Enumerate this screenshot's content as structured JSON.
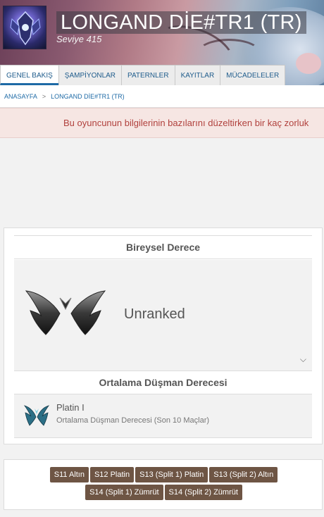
{
  "profile": {
    "name": "LONGAND DİE#TR1 (TR)",
    "level": "Seviye 415"
  },
  "tabs": [
    {
      "label": "GENEL BAKIŞ",
      "active": true
    },
    {
      "label": "ŞAMPİYONLAR",
      "active": false
    },
    {
      "label": "PATERNLER",
      "active": false
    },
    {
      "label": "KAYITLAR",
      "active": false
    },
    {
      "label": "MÜCADELELER",
      "active": false
    }
  ],
  "breadcrumb": {
    "home": "ANASAYFA",
    "separator": ">",
    "current": "LONGAND DİE#TR1 (TR)"
  },
  "alert": {
    "text": "Bu oyuncunun bilgilerinin bazılarını düzeltirken bir kaç zorluk"
  },
  "ranked": {
    "section_title": "Bireysel Derece",
    "status": "Unranked",
    "expand_icon": "chevron-down-icon"
  },
  "enemy_rank": {
    "section_title": "Ortalama Düşman Derecesi",
    "tier": "Platin I",
    "subtitle": "Ortalama Düşman Derecesi (Son 10 Maçlar)"
  },
  "seasons": [
    "S11 Altın",
    "S12 Platin",
    "S13 (Split 1) Platin",
    "S13 (Split 2) Altın",
    "S14 (Split 1) Zümrüt",
    "S14 (Split 2) Zümrüt"
  ],
  "colors": {
    "link": "#1e6aa6",
    "alert_text": "#b1413d",
    "alert_bg": "#f6e6e3",
    "badge_bg": "#6e5544"
  }
}
